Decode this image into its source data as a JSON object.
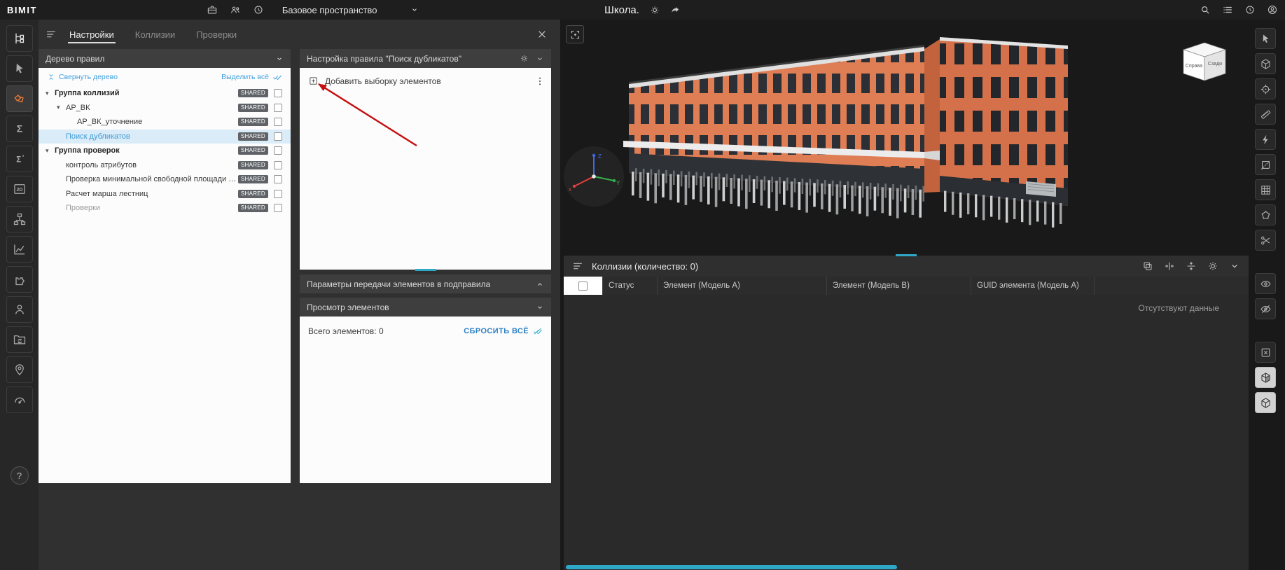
{
  "topbar": {
    "logo": "BIMIT",
    "left_icons": [
      {
        "name": "projects",
        "icon": "briefcase"
      },
      {
        "name": "team",
        "icon": "users"
      },
      {
        "name": "history",
        "icon": "clock"
      }
    ],
    "workspace_selector": {
      "label": "Базовое пространство"
    },
    "project_title": "Школа.",
    "title_icons": [
      {
        "name": "project-settings",
        "icon": "gear"
      },
      {
        "name": "share",
        "icon": "share"
      }
    ],
    "right_icons": [
      {
        "name": "search",
        "icon": "search"
      },
      {
        "name": "task-list",
        "icon": "menulist"
      },
      {
        "name": "recent",
        "icon": "clock"
      },
      {
        "name": "profile",
        "icon": "profile"
      }
    ]
  },
  "left_toolbar": {
    "tools": [
      {
        "name": "model-structure",
        "icon": "tree"
      },
      {
        "name": "select-tool",
        "icon": "cursor"
      },
      {
        "name": "collision-rules",
        "icon": "clash",
        "active": true
      },
      {
        "name": "summary",
        "icon": "sigma"
      },
      {
        "name": "calculations",
        "icon": "sigma2"
      },
      {
        "name": "view-2d",
        "icon": "twod"
      },
      {
        "name": "hierarchy",
        "icon": "hier"
      },
      {
        "name": "charts",
        "icon": "chart"
      },
      {
        "name": "plugins",
        "icon": "puzzle"
      },
      {
        "name": "users",
        "icon": "person"
      },
      {
        "name": "shared-folders",
        "icon": "foldersync"
      },
      {
        "name": "user-location",
        "icon": "personpin"
      },
      {
        "name": "dashboard",
        "icon": "gauge"
      }
    ],
    "help_label": "?"
  },
  "tabs": {
    "items": [
      {
        "name": "settings",
        "label": "Настройки",
        "active": true
      },
      {
        "name": "collisions",
        "label": "Коллизии",
        "active": false
      },
      {
        "name": "checks",
        "label": "Проверки",
        "active": false
      }
    ]
  },
  "rule_tree_panel": {
    "title": "Дерево правил",
    "collapse_tree_label": "Свернуть дерево",
    "select_all_label": "Выделить всё",
    "items": [
      {
        "label": "Группа коллизий",
        "level": 0,
        "bold": true,
        "expandable": true,
        "badge": "SHARED"
      },
      {
        "label": "АР_ВК",
        "level": 1,
        "expandable": true,
        "badge": "SHARED"
      },
      {
        "label": "АР_ВК_уточнение",
        "level": 2,
        "badge": "SHARED"
      },
      {
        "label": "Поиск дубликатов",
        "level": 1,
        "selected": true,
        "badge": "SHARED"
      },
      {
        "label": "Группа проверок",
        "level": 0,
        "bold": true,
        "expandable": true,
        "badge": "SHARED"
      },
      {
        "label": "контроль атрибутов",
        "level": 1,
        "badge": "SHARED"
      },
      {
        "label": "Проверка минимальной свободной площади с учето...",
        "level": 1,
        "badge": "SHARED"
      },
      {
        "label": "Расчет марша лестниц",
        "level": 1,
        "badge": "SHARED"
      },
      {
        "label": "Проверки",
        "level": 1,
        "muted": true,
        "badge": "SHARED"
      }
    ]
  },
  "rule_settings_panel": {
    "title": "Настройка правила \"Поиск дубликатов\"",
    "add_selection_label": "Добавить выборку элементов",
    "transfer_params_title": "Параметры передачи элементов в подправила",
    "preview_title": "Просмотр элементов",
    "total_elements_label": "Всего элементов: 0",
    "reset_all_label": "СБРОСИТЬ ВСЁ"
  },
  "collisions_panel": {
    "title": "Коллизии (количество: 0)",
    "columns": [
      "Статус",
      "Элемент (Модель А)",
      "Элемент (Модель B)",
      "GUID элемента (Модель А)"
    ],
    "empty_state": "Отсутствуют данные",
    "header_icons": [
      {
        "name": "duplicate",
        "icon": "copy"
      },
      {
        "name": "fit-columns",
        "icon": "fitcol"
      },
      {
        "name": "fit-rows",
        "icon": "rowfit"
      },
      {
        "name": "table-settings",
        "icon": "gear"
      },
      {
        "name": "collapse-panel",
        "icon": "chevdown"
      }
    ]
  },
  "right_toolbar": {
    "groups": [
      {
        "tools": [
          {
            "name": "select-elements",
            "icon": "cursor"
          },
          {
            "name": "model-box",
            "icon": "box3d"
          },
          {
            "name": "locate",
            "icon": "target"
          },
          {
            "name": "measure",
            "icon": "ruler"
          },
          {
            "name": "quick-check",
            "icon": "bolt"
          },
          {
            "name": "section-plane",
            "icon": "sectionplane"
          },
          {
            "name": "grid",
            "icon": "grid"
          },
          {
            "name": "polygon-select",
            "icon": "polygonsel"
          },
          {
            "name": "clip",
            "icon": "scissors"
          }
        ]
      },
      {
        "tools": [
          {
            "name": "show-elements",
            "icon": "eye"
          },
          {
            "name": "hide-elements",
            "icon": "eyeoff"
          }
        ]
      },
      {
        "tools": [
          {
            "name": "isolate",
            "icon": "boxx"
          },
          {
            "name": "shaded-view",
            "icon": "halfbox",
            "active": true
          },
          {
            "name": "section-box",
            "icon": "box3d",
            "active": true
          }
        ]
      }
    ]
  },
  "viewport": {
    "nav_cube": {
      "face_right": "Справа",
      "face_back": "Сзади"
    },
    "axis_labels": {
      "x": "x",
      "y": "Y",
      "z": "Z"
    }
  },
  "colors": {
    "accent_teal": "#2fa8c8",
    "accent_blue": "#3f9ad6",
    "selection_bg": "#d9ecf8",
    "active_tool_orange": "#e5793a",
    "building_orange": "#df7e55",
    "annotation_red": "#c41010"
  }
}
